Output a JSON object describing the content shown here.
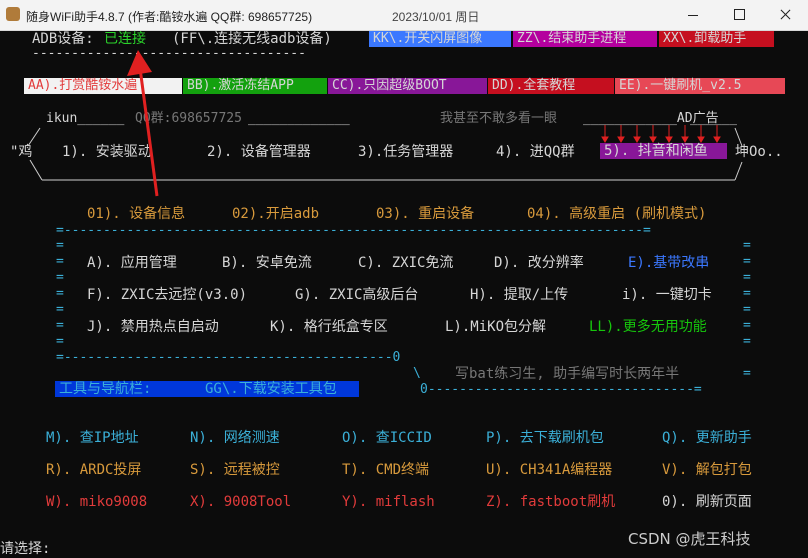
{
  "titlebar": {
    "title": "随身WiFi助手4.8.7 (作者:酷铵水遍 QQ群: 698657725)",
    "date": "2023/10/01 周日"
  },
  "status": {
    "adb_label": "ADB设备:",
    "adb_state": "已连接",
    "wireless_hint": "(FF\\.连接无线adb设备)",
    "underline": "-----------------------------------"
  },
  "top_buttons": {
    "kk": "KK\\.开关闪屏图像",
    "zz": "ZZ\\.结束助手进程",
    "xx": "XX\\.卸载助手"
  },
  "row_buttons": {
    "aa": "AA).打赏酷铵水遍",
    "bb": "BB).激活冻结APP",
    "cc": "CC).只因超级BOOT",
    "dd": "DD).全套教程",
    "ee": "EE).一键刷机_v2.5"
  },
  "banner": {
    "ikun": "ikun______",
    "qq": "QQ群:698657725",
    "line": "_____________",
    "slogan": "我甚至不敢多看一眼",
    "ad_line": "____________AD广告",
    "ad_tail": "______",
    "ji": "\"鸡",
    "item1": "1). 安装驱动",
    "item2": "2). 设备管理器",
    "item3": "3).任务管理器",
    "item4": "4). 进QQ群",
    "item5": "5). 抖音和闲鱼",
    "kun": "坤Oo.."
  },
  "yellow_menu": {
    "m01": "01). 设备信息",
    "m02": "02).开启adb",
    "m03": "03). 重启设备",
    "m04": "04). 高级重启 (刷机模式)"
  },
  "box": {
    "top_border": "=--------------------------------------------------------------------------=",
    "side": "=",
    "row1": [
      {
        "k": "a",
        "text": "A). 应用管理"
      },
      {
        "k": "b",
        "text": "B). 安卓免流"
      },
      {
        "k": "c",
        "text": "C). ZXIC免流"
      },
      {
        "k": "d",
        "text": "D). 改分辨率"
      },
      {
        "k": "e",
        "text": "E).基带改串"
      }
    ],
    "row2": [
      {
        "k": "f",
        "text": "F). ZXIC去远控(v3.0)"
      },
      {
        "k": "g",
        "text": "G). ZXIC高级后台"
      },
      {
        "k": "h",
        "text": "H). 提取/上传"
      },
      {
        "k": "i",
        "text": "i). 一键切卡"
      }
    ],
    "row3": [
      {
        "k": "j",
        "text": "J). 禁用热点自启动"
      },
      {
        "k": "k",
        "text": "K). 格行纸盒专区"
      },
      {
        "k": "l",
        "text": "L).MiKO包分解"
      },
      {
        "k": "ll",
        "text": "LL).更多无用功能"
      }
    ],
    "mid_border": "=------------------------------------------0",
    "slash": "\\",
    "motto": "写bat练习生, 助手编写时长两年半",
    "bottom_border": "0----------------------------------=",
    "tools_label": "工具与导航栏:",
    "tools_gg": "GG\\.下载安装工具包"
  },
  "bottom_menu": {
    "row1": [
      {
        "k": "m",
        "text": "M). 查IP地址"
      },
      {
        "k": "n",
        "text": "N). 网络测速"
      },
      {
        "k": "o",
        "text": "O). 查ICCID"
      },
      {
        "k": "p",
        "text": "P). 去下载刷机包"
      },
      {
        "k": "q",
        "text": "Q). 更新助手"
      }
    ],
    "row2": [
      {
        "k": "r",
        "text": "R). ARDC投屏"
      },
      {
        "k": "s",
        "text": "S). 远程被控"
      },
      {
        "k": "t",
        "text": "T). CMD终端"
      },
      {
        "k": "u",
        "text": "U). CH341A编程器"
      },
      {
        "k": "v",
        "text": "V). 解包打包"
      }
    ],
    "row3": [
      {
        "k": "w",
        "text": "W). miko9008"
      },
      {
        "k": "x",
        "text": "X). 9008Tool"
      },
      {
        "k": "y",
        "text": "Y). miflash"
      },
      {
        "k": "z",
        "text": "Z). fastboot刷机"
      },
      {
        "k": "zero",
        "text": "0). 刷新页面"
      }
    ]
  },
  "prompt": "请选择:",
  "watermark": "CSDN @虎王科技",
  "colors": {
    "terminal_bg": "#0c0c0c",
    "kk_bg": "#3b78ff",
    "zz_bg": "#b4009e",
    "xx_bg": "#c50f1f",
    "aa_bg": "#f2f2f2",
    "bb_bg": "#13a10e",
    "cc_bg": "#881798",
    "dd_bg": "#c50f1f",
    "ee_bg": "#e74856",
    "douyin_bg": "#881798",
    "tools_bg": "#0037da",
    "annotation_red": "#e02020"
  }
}
